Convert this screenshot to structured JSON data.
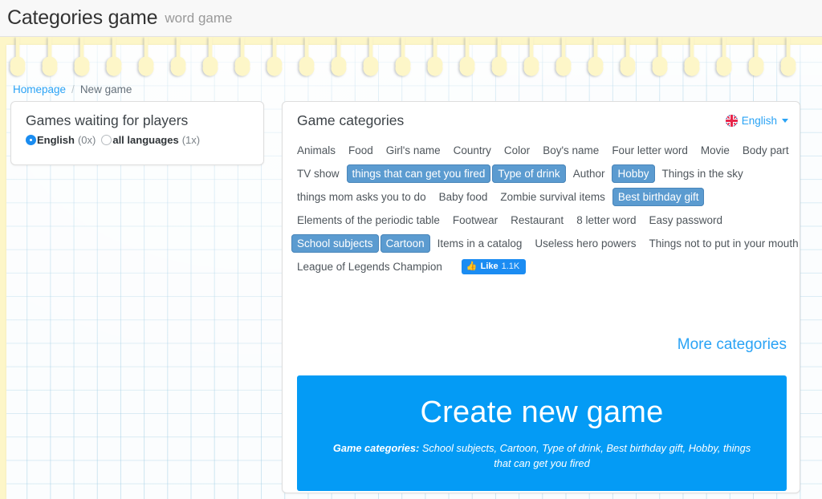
{
  "header": {
    "title": "Categories game",
    "subtitle": "word game"
  },
  "breadcrumb": {
    "home_label": "Homepage",
    "separator": "/",
    "current_label": "New game"
  },
  "left_panel": {
    "title": "Games waiting for players",
    "options": [
      {
        "label": "English",
        "count": "(0x)",
        "selected": true
      },
      {
        "label": "all languages",
        "count": "(1x)",
        "selected": false
      }
    ]
  },
  "right_panel": {
    "title": "Game categories",
    "language_select": {
      "label": "English",
      "flag_icon": "union-jack-flag-icon",
      "caret_icon": "chevron-down-icon"
    },
    "tag_rows": [
      [
        {
          "label": "Animals",
          "selected": false
        },
        {
          "label": "Food",
          "selected": false
        },
        {
          "label": "Girl's name",
          "selected": false
        },
        {
          "label": "Country",
          "selected": false
        },
        {
          "label": "Color",
          "selected": false
        },
        {
          "label": "Boy's name",
          "selected": false
        },
        {
          "label": "Four letter word",
          "selected": false
        },
        {
          "label": "Movie",
          "selected": false
        },
        {
          "label": "Body part",
          "selected": false
        }
      ],
      [
        {
          "label": "TV show",
          "selected": false
        },
        {
          "label": "things that can get you fired",
          "selected": true
        },
        {
          "label": "Type of drink",
          "selected": true
        },
        {
          "label": "Author",
          "selected": false
        },
        {
          "label": "Hobby",
          "selected": true
        },
        {
          "label": "Things in the sky",
          "selected": false
        }
      ],
      [
        {
          "label": "things mom asks you to do",
          "selected": false
        },
        {
          "label": "Baby food",
          "selected": false
        },
        {
          "label": "Zombie survival items",
          "selected": false
        },
        {
          "label": "Best birthday gift",
          "selected": true
        }
      ],
      [
        {
          "label": "Elements of the periodic table",
          "selected": false
        },
        {
          "label": "Footwear",
          "selected": false
        },
        {
          "label": "Restaurant",
          "selected": false
        },
        {
          "label": "8 letter word",
          "selected": false
        },
        {
          "label": "Easy password",
          "selected": false
        }
      ],
      [
        {
          "label": "School subjects",
          "selected": true
        },
        {
          "label": "Cartoon",
          "selected": true
        },
        {
          "label": "Items in a catalog",
          "selected": false
        },
        {
          "label": "Useless hero powers",
          "selected": false
        },
        {
          "label": "Things not to put in your mouth",
          "selected": false
        }
      ],
      [
        {
          "label": "League of Legends Champion",
          "selected": false
        }
      ]
    ],
    "like_button": {
      "icon": "thumbs-up-icon",
      "label": "Like",
      "count": "1.1K"
    },
    "more_categories_label": "More categories",
    "cta": {
      "title": "Create new game",
      "sub_label": "Game categories:",
      "sub_value": "School subjects, Cartoon, Type of drink, Best birthday gift, Hobby, things that can get you fired"
    }
  },
  "colors": {
    "accent_blue": "#049bf5",
    "link_blue": "#2aa3f5",
    "tag_selected": "#5b9bd0",
    "page_yellow": "#fdf6c8"
  }
}
